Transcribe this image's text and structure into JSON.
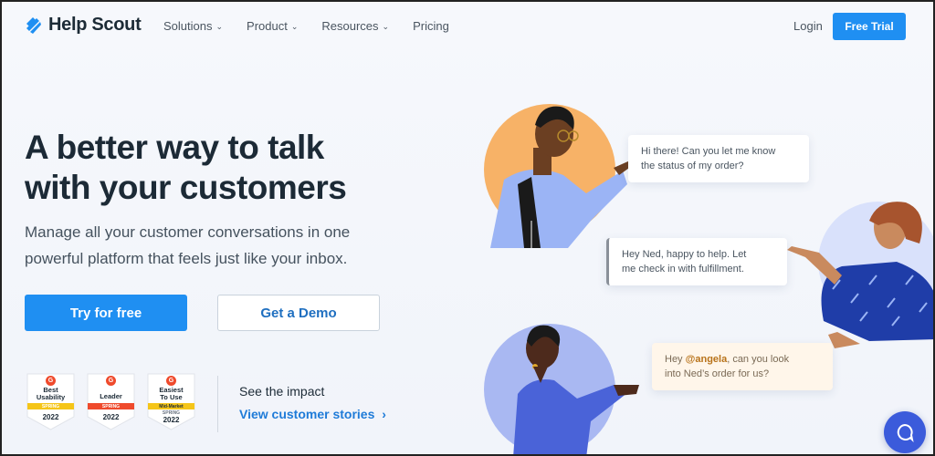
{
  "header": {
    "logo_text": "Help Scout",
    "nav": [
      {
        "label": "Solutions",
        "has_dropdown": true
      },
      {
        "label": "Product",
        "has_dropdown": true
      },
      {
        "label": "Resources",
        "has_dropdown": true
      },
      {
        "label": "Pricing",
        "has_dropdown": false
      }
    ],
    "login_label": "Login",
    "trial_label": "Free Trial"
  },
  "hero": {
    "headline_line1": "A better way to talk",
    "headline_line2": "with your customers",
    "subhead_line1": "Manage all your customer conversations in one",
    "subhead_line2": "powerful platform that feels just like your inbox.",
    "primary_cta": "Try for free",
    "secondary_cta": "Get a Demo"
  },
  "badges": [
    {
      "title_line1": "Best",
      "title_line2": "Usability",
      "ribbon": "SPRING",
      "year": "2022",
      "color": "#f5c518"
    },
    {
      "title_line1": "Leader",
      "title_line2": "",
      "ribbon": "SPRING",
      "year": "2022",
      "color": "#ef4a2c"
    },
    {
      "title_line1": "Easiest",
      "title_line2": "To Use",
      "ribbon": "Mid-Market",
      "ribbon2": "SPRING",
      "year": "2022",
      "color": "#f5c518"
    }
  ],
  "impact": {
    "label": "See the impact",
    "link": "View customer stories",
    "link_arrow": "›"
  },
  "chat": {
    "bubble1_line1": "Hi there! Can you let me know",
    "bubble1_line2": "the status of my order?",
    "bubble2_line1": "Hey Ned, happy to help. Let",
    "bubble2_line2": "me check in with fulfillment.",
    "bubble3_prefix": "Hey ",
    "bubble3_mention": "@angela",
    "bubble3_suffix": ", can you look",
    "bubble3_line2": "into Ned’s order for us?"
  },
  "colors": {
    "brand_blue": "#1f8ff2",
    "link_blue": "#1f7bd8",
    "orange_circle": "#f7b267",
    "lavender_circle": "#a9b8f2",
    "help_widget": "#3b5bdb"
  },
  "icons": {
    "logo": "help-scout-logo-icon",
    "chevron": "chevron-down-icon",
    "help": "chat-help-icon"
  }
}
